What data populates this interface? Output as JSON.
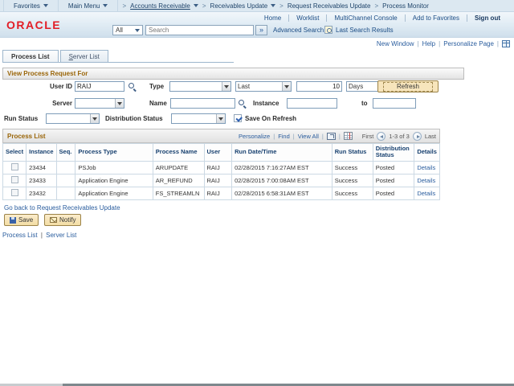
{
  "breadcrumb": {
    "favorites": "Favorites",
    "main_menu": "Main Menu",
    "crumbs": [
      {
        "label": "Accounts Receivable"
      },
      {
        "label": "Receivables Update"
      },
      {
        "label": "Request Receivables Update"
      },
      {
        "label": "Process Monitor"
      }
    ]
  },
  "header": {
    "logo": "ORACLE",
    "top_links": {
      "home": "Home",
      "worklist": "Worklist",
      "multichannel": "MultiChannel Console",
      "add_to_favorites": "Add to Favorites",
      "sign_out": "Sign out"
    },
    "search": {
      "scope": "All",
      "placeholder": "Search",
      "advanced": "Advanced Search",
      "last_results": "Last Search Results"
    }
  },
  "page_actions": {
    "new_window": "New Window",
    "help": "Help",
    "personalize_page": "Personalize Page"
  },
  "tabs": {
    "process_list": "Process List",
    "server_list": "Server List"
  },
  "filter": {
    "title": "View Process Request For",
    "user_id_label": "User ID",
    "user_id_value": "RAIJ",
    "type_label": "Type",
    "type_value": "",
    "last_value": "Last",
    "days_count": "10",
    "days_unit": "Days",
    "refresh_label": "Refresh",
    "server_label": "Server",
    "server_value": "",
    "name_label": "Name",
    "name_value": "",
    "instance_label": "Instance",
    "instance_from": "",
    "to_label": "to",
    "instance_to": "",
    "run_status_label": "Run Status",
    "run_status_value": "",
    "distribution_status_label": "Distribution Status",
    "distribution_status_value": "",
    "save_on_refresh_label": "Save On Refresh",
    "save_on_refresh_checked": true
  },
  "grid": {
    "title": "Process List",
    "toolbar": {
      "personalize": "Personalize",
      "find": "Find",
      "view_all": "View All"
    },
    "pager": {
      "first": "First",
      "range": "1-3 of 3",
      "last": "Last"
    },
    "columns": {
      "select": "Select",
      "instance": "Instance",
      "seq": "Seq.",
      "process_type": "Process Type",
      "process_name": "Process Name",
      "user": "User",
      "run_datetime": "Run Date/Time",
      "run_status": "Run Status",
      "distribution_status": "Distribution Status",
      "details": "Details"
    },
    "rows": [
      {
        "instance": "23434",
        "seq": "",
        "process_type": "PSJob",
        "process_name": "ARUPDATE",
        "user": "RAIJ",
        "run_datetime": "02/28/2015  7:16:27AM EST",
        "run_status": "Success",
        "distribution_status": "Posted",
        "details": "Details"
      },
      {
        "instance": "23433",
        "seq": "",
        "process_type": "Application Engine",
        "process_name": "AR_REFUND",
        "user": "RAIJ",
        "run_datetime": "02/28/2015  7:00:08AM EST",
        "run_status": "Success",
        "distribution_status": "Posted",
        "details": "Details"
      },
      {
        "instance": "23432",
        "seq": "",
        "process_type": "Application Engine",
        "process_name": "FS_STREAMLN",
        "user": "RAIJ",
        "run_datetime": "02/28/2015  6:58:31AM EST",
        "run_status": "Success",
        "distribution_status": "Posted",
        "details": "Details"
      }
    ]
  },
  "footer": {
    "go_back": "Go back to Request Receivables Update",
    "save": "Save",
    "notify": "Notify",
    "process_list": "Process List",
    "server_list": "Server List"
  },
  "colors": {
    "oracle_red": "#e21d26",
    "section_title": "#9a6508",
    "link_blue": "#2a5d9e",
    "band_blue": "#cfdfec"
  }
}
